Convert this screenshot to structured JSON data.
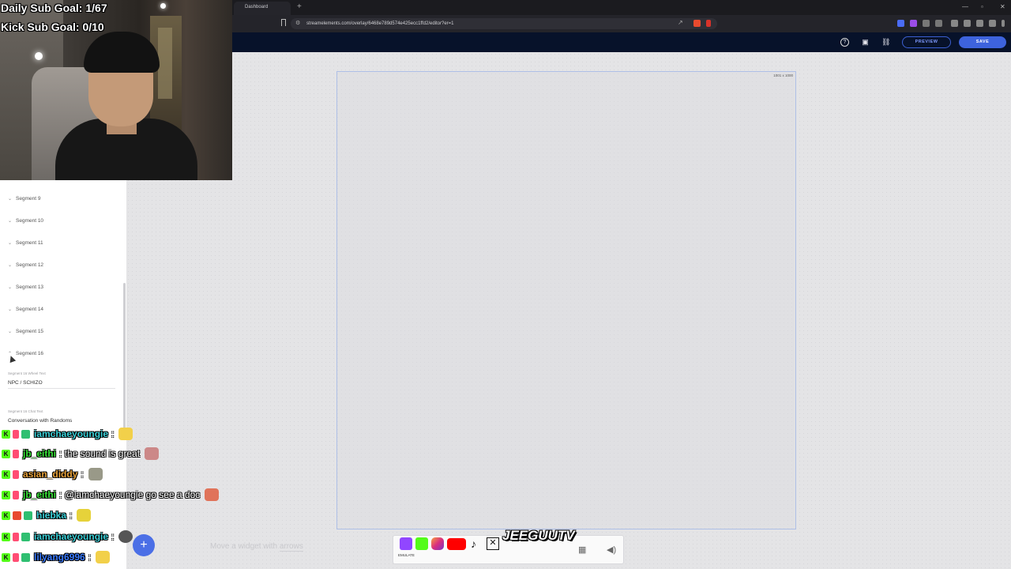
{
  "stream_overlay": {
    "daily_goal": "Daily Sub Goal: 1/67",
    "kick_goal": "Kick Sub Goal: 0/10"
  },
  "browser": {
    "tab_title": "Dashboard",
    "url": "streamelements.com/overlay/6468e789d574e425ecc1ffd2/editor?er=1"
  },
  "editor": {
    "preview_label": "PREVIEW",
    "save_label": "SAVE",
    "canvas_size": "1001 x 1000",
    "hint_text": "Move a widget with",
    "hint_key": "arrows",
    "emulate_label": "EMULATE"
  },
  "settings": {
    "segments": [
      "Segment 9",
      "Segment 10",
      "Segment 11",
      "Segment 12",
      "Segment 13",
      "Segment 14",
      "Segment 15",
      "Segment 16"
    ],
    "field1_label": "Segment 16 Wheel Text",
    "field1_value": "NPC / SCHIZO",
    "field2_label": "Segment 16 Chat Text",
    "field2_value": "Conversation with Randoms"
  },
  "chat": {
    "messages": [
      {
        "user": "iamchaeyoungie",
        "text": ":",
        "color": "#3ad0d8"
      },
      {
        "user": "jb_eithi",
        "text": ": the sound is great",
        "color": "#39e639"
      },
      {
        "user": "asian_diddy",
        "text": ":",
        "color": "#e8a23a"
      },
      {
        "user": "jb_eithi",
        "text": ": @iamchaeyoungie go see a doc",
        "color": "#39e639"
      },
      {
        "user": "hiebka",
        "text": ":",
        "color": "#3ad0d8"
      },
      {
        "user": "iamchaeyoungie",
        "text": ":",
        "color": "#3ad0d8"
      },
      {
        "user": "lilyang6996",
        "text": ":",
        "color": "#3a7bff"
      }
    ]
  },
  "colors": {
    "accent": "#3d63dd",
    "editor_bar": "#07122a",
    "canvas_bg": "#e4e4e6"
  }
}
